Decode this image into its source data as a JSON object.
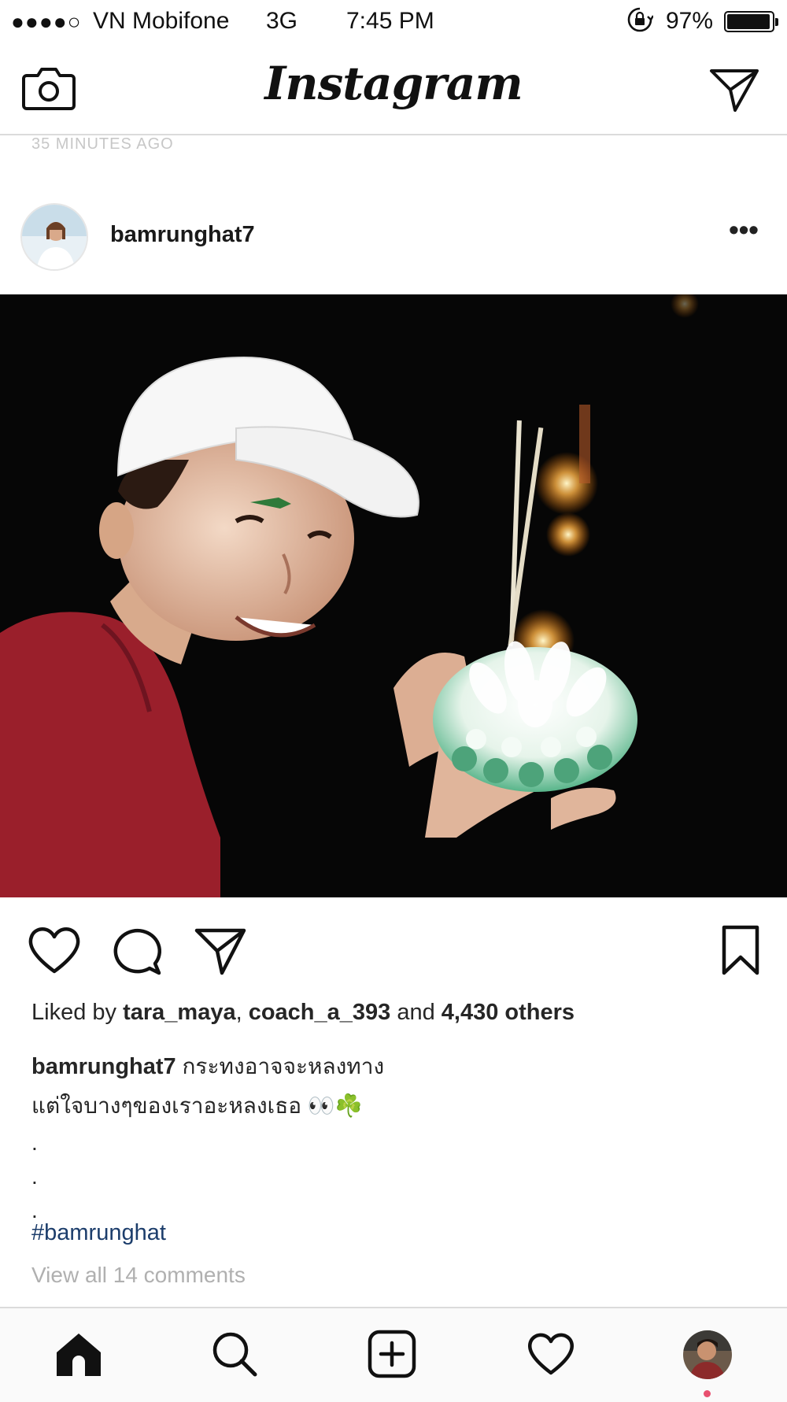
{
  "status_bar": {
    "signal": "●●●●○",
    "carrier": "VN Mobifone",
    "network": "3G",
    "time": "7:45 PM",
    "battery_percent": "97%",
    "battery_level": 0.97,
    "orientation_lock_icon": "orientation-lock-icon"
  },
  "top_nav": {
    "logo": "Instagram",
    "camera_icon": "camera-icon",
    "direct_icon": "paper-plane-icon"
  },
  "previous_post_time": "35 MINUTES AGO",
  "post": {
    "username": "bamrunghat7",
    "more_icon_glyph": "•••",
    "liked_by_prefix": "Liked by ",
    "liked_by_user1": "tara_maya",
    "liked_by_sep": ", ",
    "liked_by_user2": "coach_a_393",
    "liked_by_and": " and ",
    "liked_by_count": "4,430 others",
    "caption_user": "bamrunghat7",
    "caption_line1": "กระทงอาจจะหลงทาง",
    "caption_line2": "แต่ใจบางๆของเราอะหลงเธอ 👀☘️",
    "caption_dots": [
      ".",
      ".",
      "."
    ],
    "hashtag": "#bamrunghat",
    "view_comments": "View all 14 comments"
  },
  "colors": {
    "accent_link": "#1c3d6b",
    "muted_text": "#b0b0b0",
    "divider": "#dbdbdb",
    "notification_dot": "#e8506f"
  },
  "tab_bar": {
    "icons": [
      "home-icon",
      "search-icon",
      "add-post-icon",
      "heart-icon",
      "profile-avatar"
    ]
  }
}
